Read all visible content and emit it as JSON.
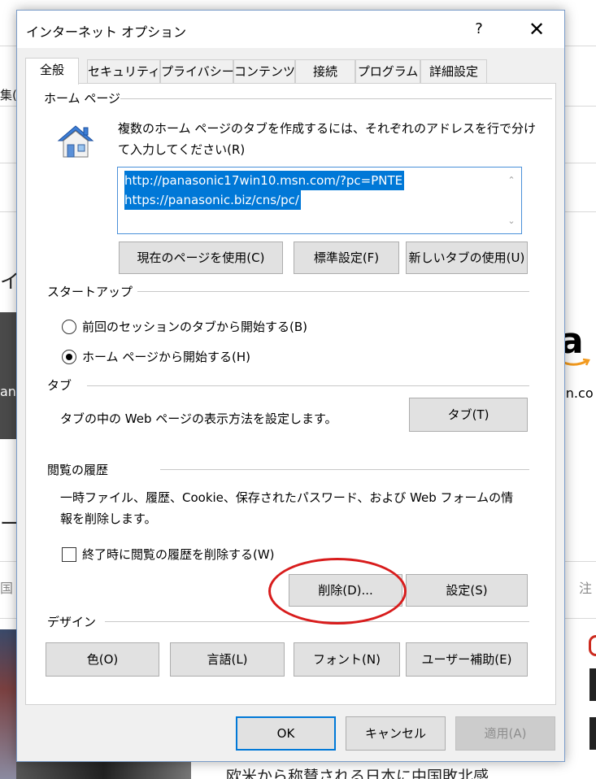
{
  "background": {
    "left_fragments": [
      "集(E)",
      "イト",
      "an",
      "ート",
      "国"
    ],
    "right_fragments": [
      "on.co",
      "注"
    ],
    "bottom_text": "欧米から称賛される日本に中国敗北感",
    "amazon_logo_letter": "a"
  },
  "dialog": {
    "title": "インターネット オプション",
    "help_label": "?",
    "close_label": "✕",
    "tabs": [
      {
        "label": "全般",
        "active": true
      },
      {
        "label": "セキュリティ",
        "active": false
      },
      {
        "label": "プライバシー",
        "active": false
      },
      {
        "label": "コンテンツ",
        "active": false
      },
      {
        "label": "接続",
        "active": false
      },
      {
        "label": "プログラム",
        "active": false
      },
      {
        "label": "詳細設定",
        "active": false
      }
    ],
    "homepage": {
      "group_label": "ホーム ページ",
      "description_line1": "複数のホーム ページのタブを作成するには、それぞれのアドレスを行で分け",
      "description_line2": "て入力してください(R)",
      "urls": [
        "http://panasonic17win10.msn.com/?pc=PNTE",
        "https://panasonic.biz/cns/pc/"
      ],
      "buttons": {
        "use_current": "現在のページを使用(C)",
        "use_default": "標準設定(F)",
        "use_new_tab": "新しいタブの使用(U)"
      },
      "icon": "house-icon"
    },
    "startup": {
      "group_label": "スタートアップ",
      "option_last_session": "前回のセッションのタブから開始する(B)",
      "option_home_page": "ホーム ページから開始する(H)",
      "selected": "home_page"
    },
    "tabs_section": {
      "group_label": "タブ",
      "description": "タブの中の Web ページの表示方法を設定します。",
      "button": "タブ(T)"
    },
    "history": {
      "group_label": "閲覧の履歴",
      "description_line1": "一時ファイル、履歴、Cookie、保存されたパスワード、および Web フォームの情",
      "description_line2": "報を削除します。",
      "checkbox_label": "終了時に閲覧の履歴を削除する(W)",
      "checkbox_checked": false,
      "delete_button": "削除(D)...",
      "settings_button": "設定(S)"
    },
    "design": {
      "group_label": "デザイン",
      "colors_button": "色(O)",
      "languages_button": "言語(L)",
      "fonts_button": "フォント(N)",
      "accessibility_button": "ユーザー補助(E)"
    },
    "footer": {
      "ok": "OK",
      "cancel": "キャンセル",
      "apply": "適用(A)",
      "apply_enabled": false
    },
    "colors": {
      "accent": "#0078d7",
      "highlight_circle": "#d81c1c",
      "button_face": "#e1e1e1"
    }
  }
}
